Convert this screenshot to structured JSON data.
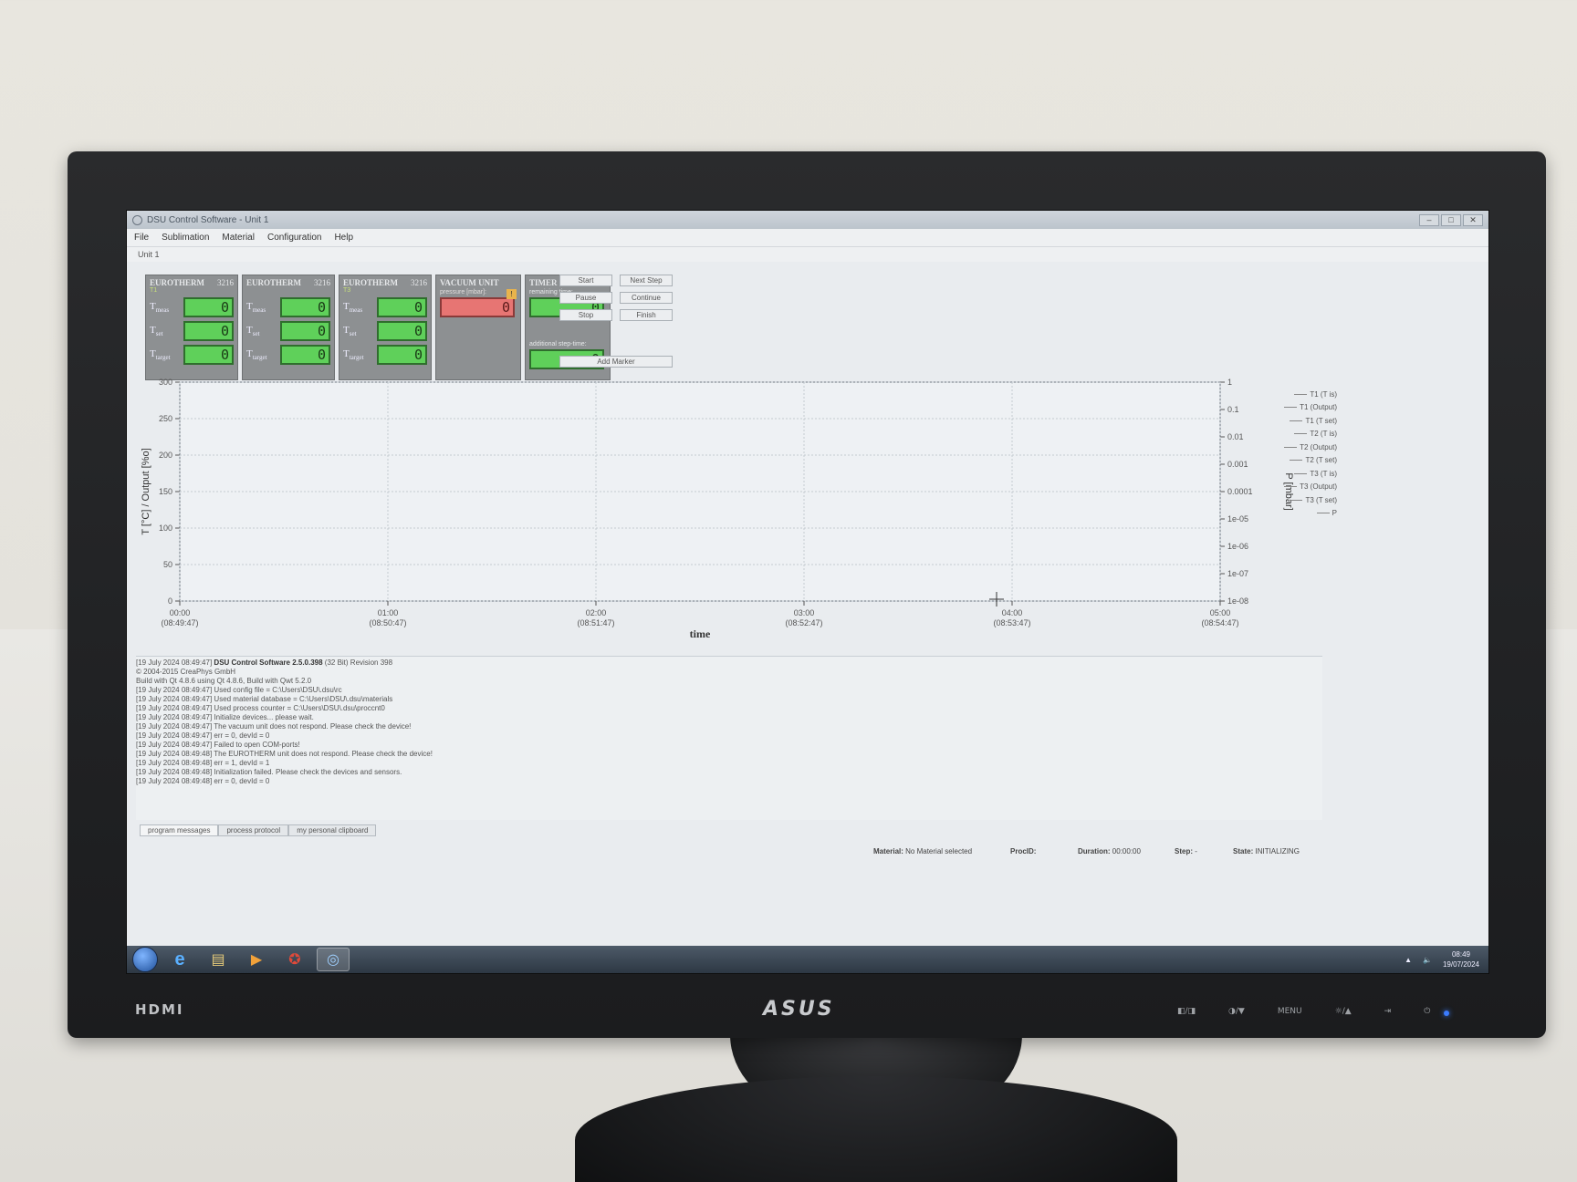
{
  "window": {
    "title": "DSU Control Software - Unit 1",
    "unit_label": "Unit 1"
  },
  "menu": [
    "File",
    "Sublimation",
    "Material",
    "Configuration",
    "Help"
  ],
  "eurotherm": [
    {
      "name": "EUROTHERM",
      "model": "3216",
      "sub": "T1",
      "t_meas": "0",
      "t_set": "0",
      "t_target": "0"
    },
    {
      "name": "EUROTHERM",
      "model": "3216",
      "sub": "",
      "t_meas": "0",
      "t_set": "0",
      "t_target": "0"
    },
    {
      "name": "EUROTHERM",
      "model": "3216",
      "sub": "T3",
      "t_meas": "0",
      "t_set": "0",
      "t_target": "0"
    }
  ],
  "row_labels": {
    "meas_main": "T",
    "meas_sub": "meas",
    "set_main": "T",
    "set_sub": "set",
    "target_main": "T",
    "target_sub": "target"
  },
  "vacuum": {
    "title": "VACUUM UNIT",
    "pressure_label": "pressure [mbar]:",
    "value": "0",
    "warn": "!"
  },
  "timer": {
    "title": "TIMER UNIT",
    "remaining_label": "remaining time:",
    "remaining_value": "0",
    "additional_label": "additional step-time:",
    "additional_value": "0"
  },
  "controls": {
    "start": "Start",
    "next_step": "Next Step",
    "pause": "Pause",
    "continue": "Continue",
    "stop": "Stop",
    "finish": "Finish",
    "add_marker": "Add Marker"
  },
  "chart_data": {
    "type": "line",
    "x_ticks": [
      {
        "top": "00:00",
        "bottom": "(08:49:47)"
      },
      {
        "top": "01:00",
        "bottom": "(08:50:47)"
      },
      {
        "top": "02:00",
        "bottom": "(08:51:47)"
      },
      {
        "top": "03:00",
        "bottom": "(08:52:47)"
      },
      {
        "top": "04:00",
        "bottom": "(08:53:47)"
      },
      {
        "top": "05:00",
        "bottom": "(08:54:47)"
      }
    ],
    "xlabel": "time",
    "ylabel_left": "T [°C] / Output [%o]",
    "ylim_left": [
      0,
      300
    ],
    "y_ticks_left": [
      0,
      50,
      100,
      150,
      200,
      250,
      300
    ],
    "ylabel_right": "P [mbar]",
    "y_ticks_right": [
      "1",
      "0.1",
      "0.01",
      "0.001",
      "0.0001",
      "1e-05",
      "1e-06",
      "1e-07",
      "1e-08"
    ],
    "y_scale_right": "log",
    "grid": true,
    "legend_placement": "right",
    "legend": [
      "T1 (T is)",
      "T1 (Output)",
      "T1 (T set)",
      "T2 (T is)",
      "T2 (Output)",
      "T2 (T set)",
      "T3 (T is)",
      "T3 (Output)",
      "T3 (T set)",
      "P"
    ],
    "series": []
  },
  "log_lines": [
    {
      "ts": "[19 July 2024 08:49:47]",
      "bold": "DSU Control Software 2.5.0.398",
      "text": " (32 Bit) Revision 398"
    },
    {
      "ts": "",
      "bold": "",
      "text": "© 2004-2015 CreaPhys GmbH"
    },
    {
      "ts": "",
      "bold": "",
      "text": "Build with Qt 4.8.6 using Qt 4.8.6, Build with Qwt 5.2.0"
    },
    {
      "ts": "[19 July 2024 08:49:47]",
      "bold": "",
      "text": " Used config file = C:\\Users\\DSU\\.dsu\\rc"
    },
    {
      "ts": "[19 July 2024 08:49:47]",
      "bold": "",
      "text": " Used material database = C:\\Users\\DSU\\.dsu\\materials"
    },
    {
      "ts": "[19 July 2024 08:49:47]",
      "bold": "",
      "text": " Used process counter = C:\\Users\\DSU\\.dsu\\proccnt0"
    },
    {
      "ts": "[19 July 2024 08:49:47]",
      "bold": "",
      "text": " Initialize devices... please wait."
    },
    {
      "ts": "[19 July 2024 08:49:47]",
      "bold": "",
      "text": " The vacuum unit does not respond. Please check the device!"
    },
    {
      "ts": "[19 July 2024 08:49:47]",
      "bold": "",
      "text": " err = 0, devId = 0"
    },
    {
      "ts": "[19 July 2024 08:49:47]",
      "bold": "",
      "text": " Failed to open COM-ports!"
    },
    {
      "ts": "[19 July 2024 08:49:48]",
      "bold": "",
      "text": " The EUROTHERM unit does not respond. Please check the device!"
    },
    {
      "ts": "[19 July 2024 08:49:48]",
      "bold": "",
      "text": " err = 1, devId = 1"
    },
    {
      "ts": "[19 July 2024 08:49:48]",
      "bold": "",
      "text": " Initialization failed. Please check the devices and sensors."
    },
    {
      "ts": "[19 July 2024 08:49:48]",
      "bold": "",
      "text": " err = 0, devId = 0"
    }
  ],
  "tabs": [
    "program messages",
    "process protocol",
    "my personal clipboard"
  ],
  "status": {
    "material_label": "Material:",
    "material_value": "No Material selected",
    "procid_label": "ProcID:",
    "duration_label": "Duration:",
    "duration_value": "00:00:00",
    "step_label": "Step:",
    "step_value": "-",
    "state_label": "State:",
    "state_value": "INITIALIZING"
  },
  "tray": {
    "time": "08:49",
    "date": "19/07/2024"
  },
  "monitor": {
    "brand": "ASUS",
    "port": "HDMI",
    "menu_btn": "MENU"
  }
}
